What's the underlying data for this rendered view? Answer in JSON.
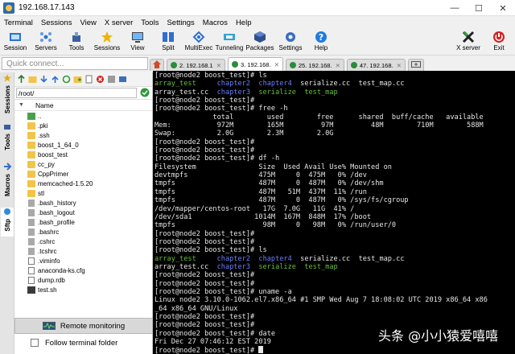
{
  "window": {
    "title": "192.168.17.143",
    "min": "—",
    "max": "☐",
    "close": "✕"
  },
  "menu": [
    "Terminal",
    "Sessions",
    "View",
    "X server",
    "Tools",
    "Settings",
    "Macros",
    "Help"
  ],
  "toolbar": [
    {
      "label": "Session",
      "icon": "session-icon"
    },
    {
      "label": "Servers",
      "icon": "servers-icon"
    },
    {
      "label": "Tools",
      "icon": "tools-icon"
    },
    {
      "label": "Sessions",
      "icon": "star-icon"
    },
    {
      "label": "View",
      "icon": "view-icon"
    },
    {
      "label": "Split",
      "icon": "split-icon"
    },
    {
      "label": "MultiExec",
      "icon": "multiexec-icon"
    },
    {
      "label": "Tunneling",
      "icon": "tunneling-icon"
    },
    {
      "label": "Packages",
      "icon": "packages-icon"
    },
    {
      "label": "Settings",
      "icon": "settings-icon"
    },
    {
      "label": "Help",
      "icon": "help-icon"
    }
  ],
  "toolbar_right": [
    {
      "label": "X server",
      "icon": "xserver-icon"
    },
    {
      "label": "Exit",
      "icon": "exit-icon"
    }
  ],
  "quick_connect": {
    "placeholder": "Quick connect..."
  },
  "tabs": [
    {
      "label": "2. 192.168.1"
    },
    {
      "label": "3. 192.168."
    },
    {
      "label": "25. 192.168."
    },
    {
      "label": "47. 192.168."
    }
  ],
  "side_tabs": [
    "Sessions",
    "Tools",
    "Macros",
    "Sftp"
  ],
  "file_panel": {
    "path": "/root/",
    "column": "Name",
    "files": [
      {
        "name": "..",
        "type": "up"
      },
      {
        "name": ".pki",
        "type": "folder"
      },
      {
        "name": ".ssh",
        "type": "folder"
      },
      {
        "name": "boost_1_64_0",
        "type": "folder"
      },
      {
        "name": "boost_test",
        "type": "folder"
      },
      {
        "name": "cc_py",
        "type": "folder"
      },
      {
        "name": "CppPrimer",
        "type": "folder"
      },
      {
        "name": "memcached-1.5.20",
        "type": "folder"
      },
      {
        "name": "stl",
        "type": "folder"
      },
      {
        "name": ".bash_history",
        "type": "file"
      },
      {
        "name": ".bash_logout",
        "type": "file"
      },
      {
        "name": ".bash_profile",
        "type": "file"
      },
      {
        "name": ".bashrc",
        "type": "file"
      },
      {
        "name": ".cshrc",
        "type": "file"
      },
      {
        "name": ".tcshrc",
        "type": "file"
      },
      {
        "name": ".viminfo",
        "type": "cfg"
      },
      {
        "name": "anaconda-ks.cfg",
        "type": "cfg"
      },
      {
        "name": "dump.rdb",
        "type": "cfg"
      },
      {
        "name": "test.sh",
        "type": "sh"
      }
    ],
    "remote_monitoring": "Remote monitoring",
    "follow_folder": "Follow terminal folder"
  },
  "terminal": {
    "lines": [
      [
        {
          "t": "[root@node2 boost_test]# ls"
        }
      ],
      [
        {
          "t": "array_test",
          "c": "g"
        },
        {
          "t": "     "
        },
        {
          "t": "chapter2",
          "c": "b"
        },
        {
          "t": "  "
        },
        {
          "t": "chapter4",
          "c": "b"
        },
        {
          "t": "  serialize.cc  test_map.cc"
        }
      ],
      [
        {
          "t": "array_test.cc  "
        },
        {
          "t": "chapter3",
          "c": "b"
        },
        {
          "t": "  "
        },
        {
          "t": "serialize",
          "c": "g"
        },
        {
          "t": "  "
        },
        {
          "t": "test_map",
          "c": "g"
        }
      ],
      [
        {
          "t": "[root@node2 boost_test]#"
        }
      ],
      [
        {
          "t": "[root@node2 boost_test]# free -h"
        }
      ],
      [
        {
          "t": "              total        used        free      shared  buff/cache   available"
        }
      ],
      [
        {
          "t": "Mem:           972M        165M         97M         48M        710M        588M"
        }
      ],
      [
        {
          "t": "Swap:          2.0G        2.3M        2.0G"
        }
      ],
      [
        {
          "t": "[root@node2 boost_test]#"
        }
      ],
      [
        {
          "t": "[root@node2 boost_test]#"
        }
      ],
      [
        {
          "t": "[root@node2 boost_test]# df -h"
        }
      ],
      [
        {
          "t": "Filesystem               Size  Used Avail Use% Mounted on"
        }
      ],
      [
        {
          "t": "devtmpfs                 475M     0  475M   0% /dev"
        }
      ],
      [
        {
          "t": "tmpfs                    487M     0  487M   0% /dev/shm"
        }
      ],
      [
        {
          "t": "tmpfs                    487M   51M  437M  11% /run"
        }
      ],
      [
        {
          "t": "tmpfs                    487M     0  487M   0% /sys/fs/cgroup"
        }
      ],
      [
        {
          "t": "/dev/mapper/centos-root   17G  7.0G   11G  41% /"
        }
      ],
      [
        {
          "t": "/dev/sda1               1014M  167M  848M  17% /boot"
        }
      ],
      [
        {
          "t": "tmpfs                     98M     0   98M   0% /run/user/0"
        }
      ],
      [
        {
          "t": "[root@node2 boost_test]#"
        }
      ],
      [
        {
          "t": "[root@node2 boost_test]#"
        }
      ],
      [
        {
          "t": "[root@node2 boost_test]# ls"
        }
      ],
      [
        {
          "t": "array_test",
          "c": "g"
        },
        {
          "t": "     "
        },
        {
          "t": "chapter2",
          "c": "b"
        },
        {
          "t": "  "
        },
        {
          "t": "chapter4",
          "c": "b"
        },
        {
          "t": "  serialize.cc  test_map.cc"
        }
      ],
      [
        {
          "t": "array_test.cc  "
        },
        {
          "t": "chapter3",
          "c": "b"
        },
        {
          "t": "  "
        },
        {
          "t": "serialize",
          "c": "g"
        },
        {
          "t": "  "
        },
        {
          "t": "test_map",
          "c": "g"
        }
      ],
      [
        {
          "t": "[root@node2 boost_test]#"
        }
      ],
      [
        {
          "t": "[root@node2 boost_test]#"
        }
      ],
      [
        {
          "t": "[root@node2 boost_test]# uname -a"
        }
      ],
      [
        {
          "t": "Linux node2 3.10.0-1062.el7.x86_64 #1 SMP Wed Aug 7 18:08:02 UTC 2019 x86_64 x86"
        }
      ],
      [
        {
          "t": "_64 x86_64 GNU/Linux"
        }
      ],
      [
        {
          "t": "[root@node2 boost_test]#"
        }
      ],
      [
        {
          "t": "[root@node2 boost_test]#"
        }
      ],
      [
        {
          "t": "[root@node2 boost_test]# date"
        }
      ],
      [
        {
          "t": "Fri Dec 27 07:46:12 EST 2019"
        }
      ],
      [
        {
          "t": "[root@node2 boost_test]# "
        }
      ]
    ]
  },
  "watermark": "头条 @小小猿爱嘻嘻",
  "colors": {
    "prompt_green": "#66bf3a",
    "dir_blue": "#6b7cff",
    "terminal_bg": "#000000"
  }
}
